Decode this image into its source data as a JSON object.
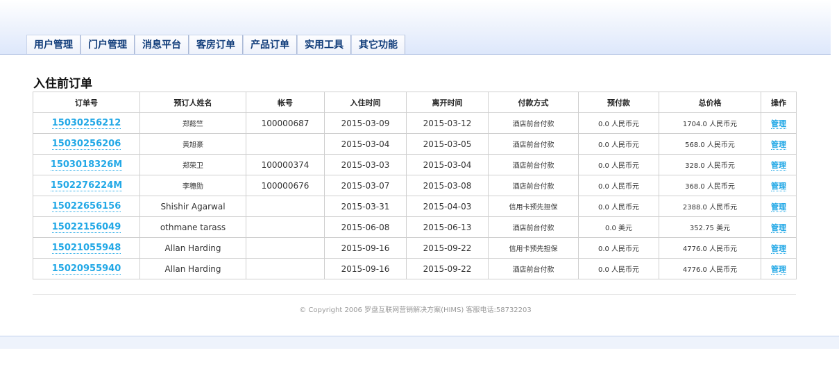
{
  "nav": {
    "items": [
      "用户管理",
      "门户管理",
      "消息平台",
      "客房订单",
      "产品订单",
      "实用工具",
      "其它功能"
    ]
  },
  "page": {
    "title": "入住前订单"
  },
  "table": {
    "headers": [
      "订单号",
      "预订人姓名",
      "帐号",
      "入住时间",
      "离开时间",
      "付款方式",
      "预付款",
      "总价格",
      "操作"
    ],
    "rows": [
      [
        "15030256212",
        "郑懿竺",
        "100000687",
        "2015-03-09",
        "2015-03-12",
        "酒店前台付款",
        "0.0 人民币元",
        "1704.0 人民币元",
        "管理"
      ],
      [
        "15030256206",
        "黄旭豪",
        "",
        "2015-03-04",
        "2015-03-05",
        "酒店前台付款",
        "0.0 人民币元",
        "568.0 人民币元",
        "管理"
      ],
      [
        "1503018326M",
        "郑荣卫",
        "100000374",
        "2015-03-03",
        "2015-03-04",
        "酒店前台付款",
        "0.0 人民币元",
        "328.0 人民币元",
        "管理"
      ],
      [
        "1502276224M",
        "李穗勋",
        "100000676",
        "2015-03-07",
        "2015-03-08",
        "酒店前台付款",
        "0.0 人民币元",
        "368.0 人民币元",
        "管理"
      ],
      [
        "15022656156",
        "Shishir Agarwal",
        "",
        "2015-03-31",
        "2015-04-03",
        "信用卡预先担保",
        "0.0 人民币元",
        "2388.0 人民币元",
        "管理"
      ],
      [
        "15022156049",
        "othmane tarass",
        "",
        "2015-06-08",
        "2015-06-13",
        "酒店前台付款",
        "0.0 美元",
        "352.75 美元",
        "管理"
      ],
      [
        "15021055948",
        "Allan Harding",
        "",
        "2015-09-16",
        "2015-09-22",
        "信用卡预先担保",
        "0.0 人民币元",
        "4776.0 人民币元",
        "管理"
      ],
      [
        "15020955940",
        "Allan Harding",
        "",
        "2015-09-16",
        "2015-09-22",
        "酒店前台付款",
        "0.0 人民币元",
        "4776.0 人民币元",
        "管理"
      ]
    ]
  },
  "footer": {
    "copyright": "© Copyright 2006 罗盘互联网营销解决方案(HIMS) 客服电话:58732203"
  }
}
